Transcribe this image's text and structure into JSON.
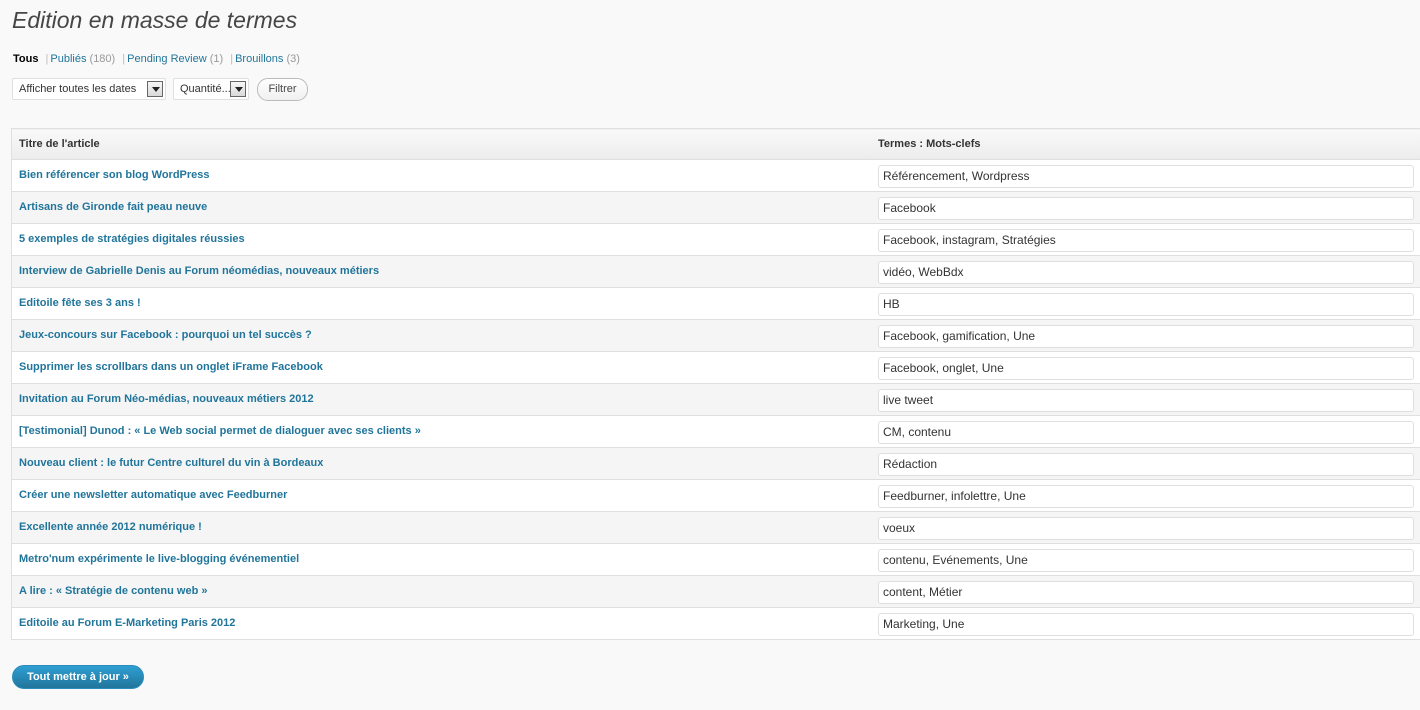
{
  "page": {
    "title": "Edition en masse de termes"
  },
  "views": [
    {
      "label": "Tous",
      "count": "",
      "current": true
    },
    {
      "label": "Publiés",
      "count": "(180)",
      "current": false
    },
    {
      "label": "Pending Review",
      "count": "(1)",
      "current": false
    },
    {
      "label": "Brouillons",
      "count": "(3)",
      "current": false
    }
  ],
  "filters": {
    "dates_select": "Afficher toutes les dates",
    "quantity_select": "Quantité...",
    "filter_button": "Filtrer"
  },
  "table": {
    "col_title": "Titre de l'article",
    "col_terms": "Termes : Mots-clefs",
    "rows": [
      {
        "title": "Bien référencer son blog WordPress",
        "terms": "Référencement, Wordpress"
      },
      {
        "title": "Artisans de Gironde fait peau neuve",
        "terms": "Facebook"
      },
      {
        "title": "5 exemples de stratégies digitales réussies",
        "terms": "Facebook, instagram, Stratégies"
      },
      {
        "title": "Interview de Gabrielle Denis au Forum néomédias, nouveaux métiers",
        "terms": "vidéo, WebBdx"
      },
      {
        "title": "Editoile fête ses 3 ans !",
        "terms": "HB"
      },
      {
        "title": "Jeux-concours sur Facebook : pourquoi un tel succès ?",
        "terms": "Facebook, gamification, Une"
      },
      {
        "title": "Supprimer les scrollbars dans un onglet iFrame Facebook",
        "terms": "Facebook, onglet, Une"
      },
      {
        "title": "Invitation au Forum Néo-médias, nouveaux métiers 2012",
        "terms": "live tweet"
      },
      {
        "title": "[Testimonial] Dunod : « Le Web social permet de dialoguer avec ses clients »",
        "terms": "CM, contenu"
      },
      {
        "title": "Nouveau client : le futur Centre culturel du vin à Bordeaux",
        "terms": "Rédaction"
      },
      {
        "title": "Créer une newsletter automatique avec Feedburner",
        "terms": "Feedburner, infolettre, Une"
      },
      {
        "title": "Excellente année 2012 numérique !",
        "terms": "voeux"
      },
      {
        "title": "Metro'num expérimente le live-blogging événementiel",
        "terms": "contenu, Evénements, Une"
      },
      {
        "title": "A lire : « Stratégie de contenu web »",
        "terms": "content, Métier"
      },
      {
        "title": "Editoile au Forum E-Marketing Paris 2012",
        "terms": "Marketing, Une"
      }
    ]
  },
  "actions": {
    "update_all": "Tout mettre à jour »"
  },
  "colors": {
    "link": "#21759b",
    "primary_button": "#21759b",
    "background": "#f9f9f9"
  }
}
